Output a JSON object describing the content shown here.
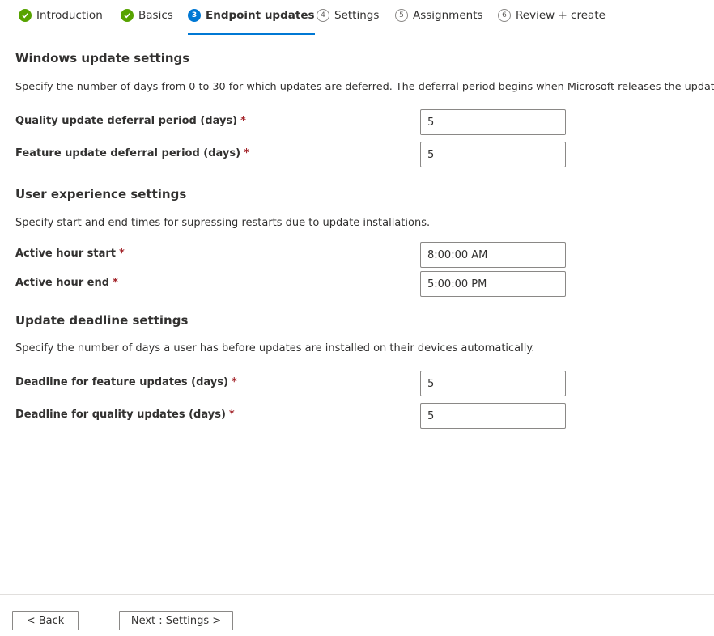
{
  "wizard": {
    "steps": [
      {
        "label": "Introduction",
        "state": "done",
        "marker": ""
      },
      {
        "label": "Basics",
        "state": "done",
        "marker": ""
      },
      {
        "label": "Endpoint updates",
        "state": "current",
        "marker": "3"
      },
      {
        "label": "Settings",
        "state": "pending",
        "marker": "4"
      },
      {
        "label": "Assignments",
        "state": "pending",
        "marker": "5"
      },
      {
        "label": "Review + create",
        "state": "pending",
        "marker": "6"
      }
    ],
    "accent": "#0078d4",
    "done_color": "#57a300"
  },
  "windows_update": {
    "title": "Windows update settings",
    "description": "Specify the number of days from 0 to 30 for which updates are deferred. The deferral period begins when Microsoft releases the update.",
    "quality_label": "Quality update deferral period (days)",
    "quality_value": "5",
    "feature_label": "Feature update deferral period (days)",
    "feature_value": "5"
  },
  "user_experience": {
    "title": "User experience settings",
    "description": "Specify start and end times for supressing restarts due to update installations.",
    "start_label": "Active hour start",
    "start_value": "8:00:00 AM",
    "end_label": "Active hour end",
    "end_value": "5:00:00 PM"
  },
  "deadline": {
    "title": "Update deadline settings",
    "description": "Specify the number of days a user has before updates are installed on their devices automatically.",
    "feature_label": "Deadline for feature updates (days)",
    "feature_value": "5",
    "quality_label": "Deadline for quality updates (days)",
    "quality_value": "5"
  },
  "required_marker": "*",
  "footer": {
    "back_label": "< Back",
    "next_label": "Next : Settings >"
  }
}
